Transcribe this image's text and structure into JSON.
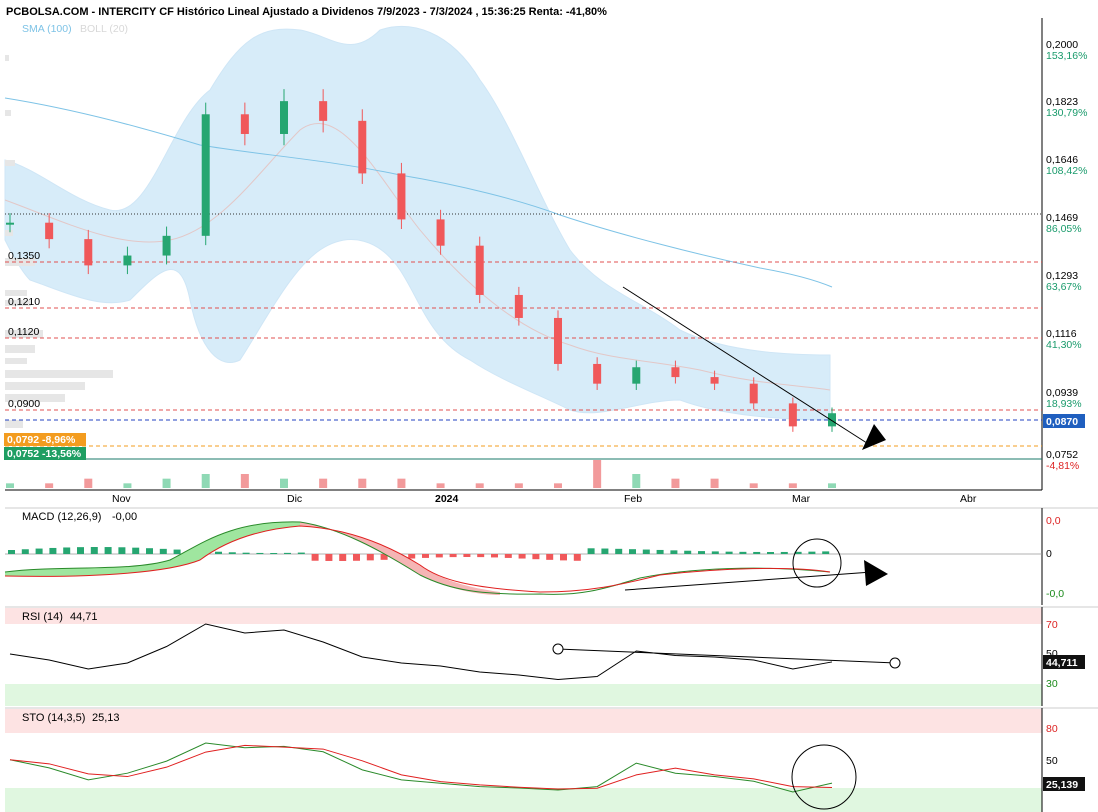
{
  "header": {
    "title": "PCBOLSA.COM - INTERCITY CF Histórico Lineal Ajustado a Dividenos 7/9/2023 - 7/3/2024 , 15:36:25 Renta: -41,80%",
    "legend_sma": "SMA (100)",
    "legend_boll": "BOLL (20)"
  },
  "colors": {
    "up": "#26a671",
    "down": "#f0585a",
    "band": "#d7ecf9",
    "sma": "#7ec3e6",
    "macd_line": "#2a8a2a",
    "signal_line": "#e02020",
    "tag_orange": "#f39c1f",
    "tag_green": "#1e9e62",
    "tag_blue": "#1f5fbf",
    "tag_black": "#111111"
  },
  "price_axis": {
    "ticks": [
      {
        "value": "0,2000",
        "pct": "153,16%"
      },
      {
        "value": "0,1823",
        "pct": "130,79%"
      },
      {
        "value": "0,1646",
        "pct": "108,42%"
      },
      {
        "value": "0,1469",
        "pct": "86,05%"
      },
      {
        "value": "0,1293",
        "pct": "63,67%"
      },
      {
        "value": "0,1116",
        "pct": "41,30%"
      },
      {
        "value": "0,0939",
        "pct": "18,93%"
      },
      {
        "value": "0,0752",
        "pct": "-4,81%"
      }
    ],
    "last_price_tag": "0,0870"
  },
  "levels": [
    {
      "label": "0,1350",
      "price": 0.135
    },
    {
      "label": "0,1210",
      "price": 0.121
    },
    {
      "label": "0,1120",
      "price": 0.112
    },
    {
      "label": "0,0900",
      "price": 0.09
    }
  ],
  "tags_left": [
    {
      "text": "0,0792  -8,96%"
    },
    {
      "text": "0,0752  -13,56%"
    }
  ],
  "months": [
    "Nov",
    "Dic",
    "2024",
    "Feb",
    "Mar",
    "Abr"
  ],
  "macd": {
    "title": "MACD (12,26,9)",
    "value": "-0,00",
    "ticks": [
      "0,0",
      "0",
      "-0,0"
    ]
  },
  "rsi": {
    "title": "RSI (14)",
    "value": "44,71",
    "ticks": [
      "70",
      "50",
      "30"
    ],
    "last_tag": "44,711"
  },
  "sto": {
    "title": "STO (14,3,5)",
    "value": "25,13",
    "ticks": [
      "80",
      "50"
    ],
    "last_tag": "25,139"
  },
  "chart_data": {
    "type": "candlestick",
    "title": "PCBOLSA.COM - INTERCITY CF Histórico Lineal Ajustado a Dividenos 7/9/2023 - 7/3/2024 , 15:36:25 Renta: -41,80%",
    "ylim": [
      0.0752,
      0.2
    ],
    "x": [
      "2023-10-09",
      "2023-10-16",
      "2023-10-23",
      "2023-10-30",
      "2023-11-06",
      "2023-11-13",
      "2023-11-20",
      "2023-11-27",
      "2023-12-04",
      "2023-12-11",
      "2023-12-18",
      "2023-12-27",
      "2024-01-08",
      "2024-01-15",
      "2024-01-22",
      "2024-01-29",
      "2024-02-05",
      "2024-02-12",
      "2024-02-19",
      "2024-02-26",
      "2024-03-04",
      "2024-03-07"
    ],
    "close": [
      0.145,
      0.14,
      0.132,
      0.135,
      0.141,
      0.178,
      0.172,
      0.182,
      0.176,
      0.16,
      0.146,
      0.138,
      0.123,
      0.116,
      0.102,
      0.096,
      0.101,
      0.098,
      0.096,
      0.09,
      0.083,
      0.087
    ],
    "volume": [
      1,
      1,
      2,
      1,
      2,
      3,
      3,
      2,
      2,
      2,
      2,
      1,
      1,
      1,
      1,
      6,
      3,
      2,
      2,
      1,
      1,
      1
    ],
    "sma_100": [
      0.182,
      0.179,
      0.176,
      0.173,
      0.17,
      0.167,
      0.164,
      0.161,
      0.158,
      0.155,
      0.151,
      0.148,
      0.145,
      0.142,
      0.139,
      0.136,
      0.133,
      0.131,
      0.129,
      0.127,
      0.125,
      0.124
    ],
    "rsi_14": [
      50,
      46,
      40,
      44,
      55,
      70,
      64,
      66,
      58,
      48,
      44,
      42,
      38,
      36,
      33,
      35,
      52,
      49,
      48,
      46,
      40,
      44.71
    ],
    "sto": [
      60,
      48,
      30,
      40,
      58,
      85,
      78,
      80,
      72,
      45,
      30,
      25,
      20,
      18,
      15,
      20,
      55,
      40,
      35,
      28,
      12,
      25.13
    ]
  }
}
